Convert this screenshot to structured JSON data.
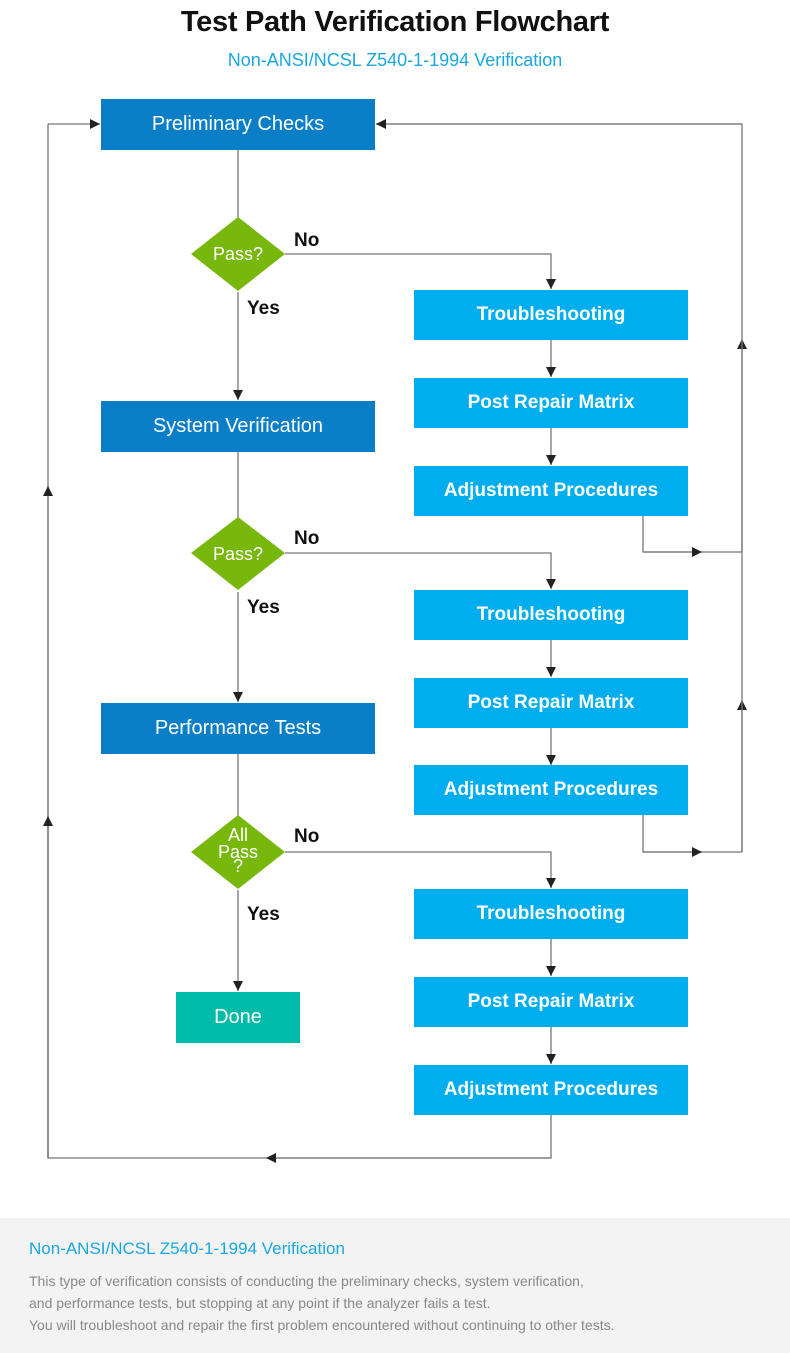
{
  "header": {
    "title": "Test Path Verification Flowchart",
    "subtitle": "Non-ANSI/NCSL Z540-1-1994 Verification"
  },
  "colors": {
    "main_step": "#0a7fc7",
    "sub_step": "#00aeef",
    "decision": "#78b80c",
    "done": "#00bba7",
    "accent_text": "#1aa7e0"
  },
  "flow": {
    "main_steps": [
      "Preliminary Checks",
      "System Verification",
      "Performance Tests"
    ],
    "decisions": [
      "Pass?",
      "Pass?",
      "All Pass ?"
    ],
    "decision_lines": [
      [
        "Pass?"
      ],
      [
        "Pass?"
      ],
      [
        "All",
        "Pass",
        "?"
      ]
    ],
    "yes_label": "Yes",
    "no_label": "No",
    "repair_steps": [
      "Troubleshooting",
      "Post Repair Matrix",
      "Adjustment Procedures"
    ],
    "done": "Done"
  },
  "footer": {
    "title": "Non-ANSI/NCSL Z540-1-1994 Verification",
    "lines": [
      "This type of verification consists of conducting the preliminary checks, system verification,",
      "and performance tests, but stopping at any point if the analyzer fails a test.",
      "You will troubleshoot and repair the first problem encountered without continuing to other tests."
    ]
  }
}
